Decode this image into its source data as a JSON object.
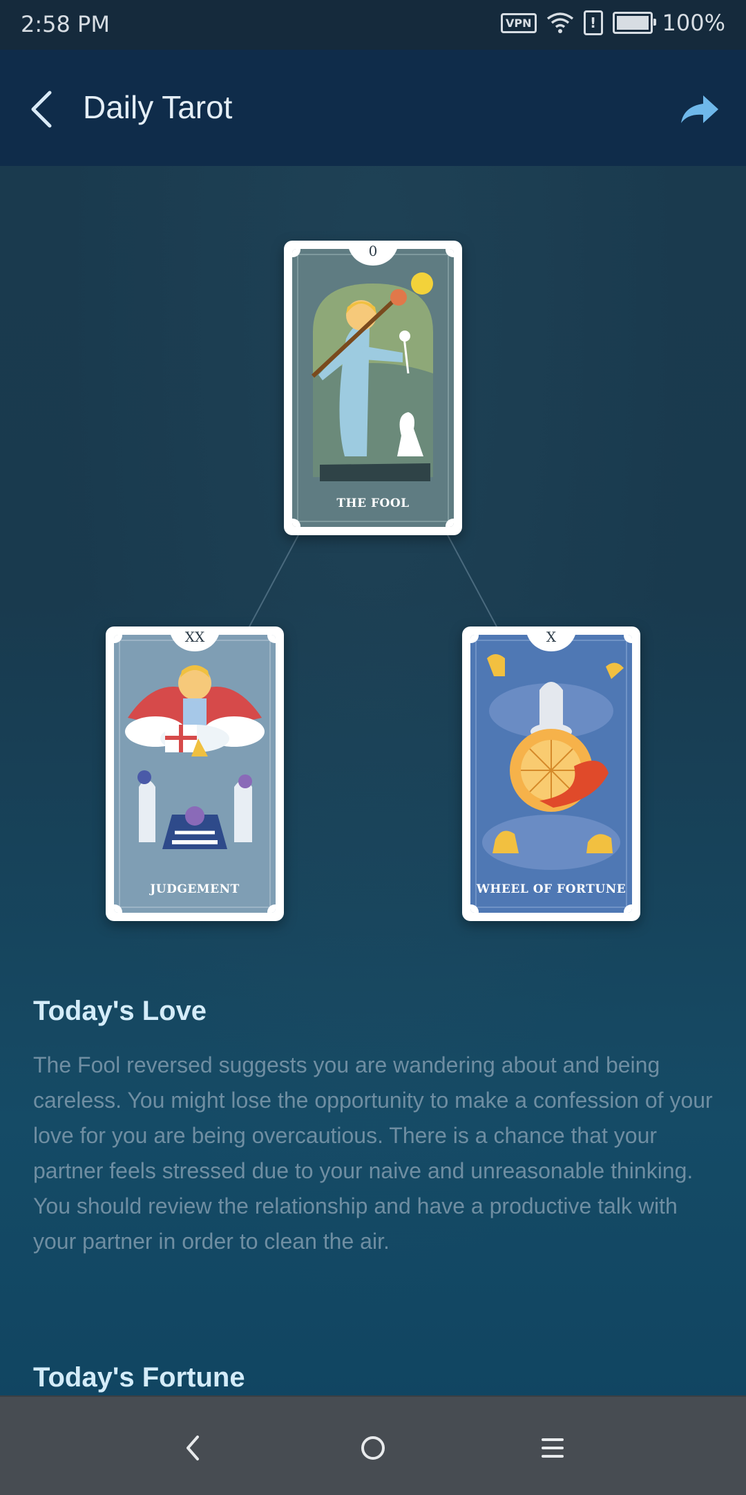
{
  "status_bar": {
    "time": "2:58 PM",
    "vpn_label": "VPN",
    "alert_label": "!",
    "battery_percent": "100%",
    "battery_level": 1.0
  },
  "app_bar": {
    "title": "Daily Tarot",
    "back_icon": "back-arrow-icon",
    "share_icon": "share-icon"
  },
  "cards": [
    {
      "numeral": "0",
      "name": "THE FOOL"
    },
    {
      "numeral": "XX",
      "name": "JUDGEMENT"
    },
    {
      "numeral": "X",
      "name": "WHEEL OF FORTUNE"
    }
  ],
  "sections": [
    {
      "title": "Today's Love",
      "body": "The Fool reversed suggests you are wandering about and being careless. You might lose the opportunity to make a confession of your love for you are being overcautious. There is a chance that your partner feels stressed due to your naive and unreasonable thinking. You should review the relationship and have a productive talk with your partner in order to clean the air."
    },
    {
      "title": "Today's Fortune"
    }
  ],
  "nav_bar": {
    "back_icon": "nav-back-icon",
    "home_icon": "nav-home-icon",
    "menu_icon": "nav-menu-icon"
  }
}
